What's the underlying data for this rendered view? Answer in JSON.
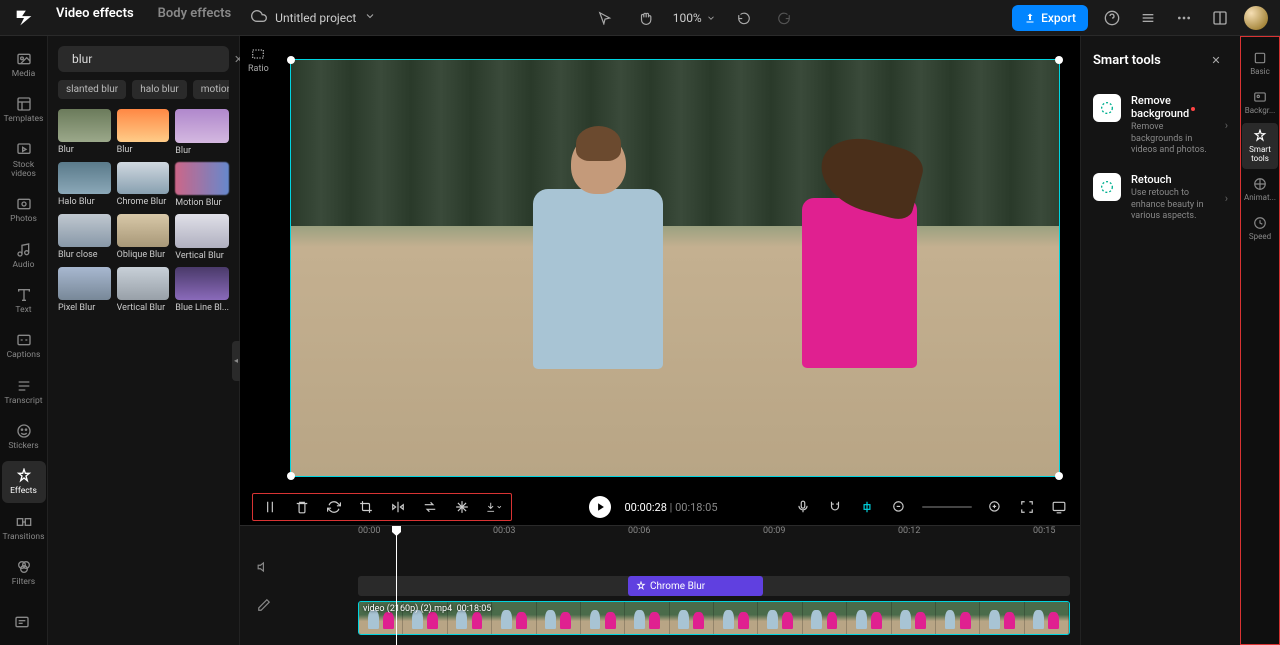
{
  "topbar": {
    "tabs": [
      "Video effects",
      "Body effects"
    ],
    "activeTab": 0,
    "projectName": "Untitled project",
    "zoom": "100%",
    "exportLabel": "Export"
  },
  "navRail": [
    {
      "label": "Media",
      "icon": "media"
    },
    {
      "label": "Templates",
      "icon": "templates"
    },
    {
      "label": "Stock videos",
      "icon": "stock"
    },
    {
      "label": "Photos",
      "icon": "photos"
    },
    {
      "label": "Audio",
      "icon": "audio"
    },
    {
      "label": "Text",
      "icon": "text"
    },
    {
      "label": "Captions",
      "icon": "captions"
    },
    {
      "label": "Transcript",
      "icon": "transcript"
    },
    {
      "label": "Stickers",
      "icon": "stickers"
    },
    {
      "label": "Effects",
      "icon": "effects"
    },
    {
      "label": "Transitions",
      "icon": "transitions"
    },
    {
      "label": "Filters",
      "icon": "filters"
    }
  ],
  "navRailActive": 9,
  "sidebar": {
    "searchValue": "blur",
    "chips": [
      "slanted blur",
      "halo blur",
      "motion bl..."
    ],
    "effects": [
      {
        "label": "Blur",
        "th": "th-1"
      },
      {
        "label": "Blur",
        "th": "th-2"
      },
      {
        "label": "Blur",
        "th": "th-3"
      },
      {
        "label": "Halo Blur",
        "th": "th-4"
      },
      {
        "label": "Chrome Blur",
        "th": "th-5"
      },
      {
        "label": "Motion Blur",
        "th": "th-6"
      },
      {
        "label": "Blur close",
        "th": "th-7"
      },
      {
        "label": "Oblique Blur",
        "th": "th-8"
      },
      {
        "label": "Vertical Blur",
        "th": "th-9"
      },
      {
        "label": "Pixel Blur",
        "th": "th-10"
      },
      {
        "label": "Vertical Blur",
        "th": "th-11"
      },
      {
        "label": "Blue Line Bl...",
        "th": "th-12"
      }
    ]
  },
  "canvas": {
    "ratioLabel": "Ratio"
  },
  "playback": {
    "current": "00:00:28",
    "duration": "00:18:05"
  },
  "timeline": {
    "ticks": [
      "00:00",
      "00:03",
      "00:06",
      "00:09",
      "00:12",
      "00:15"
    ],
    "effectClip": "Chrome Blur",
    "videoLabel": "video (2160p) (2).mp4",
    "videoDuration": "00:18:05"
  },
  "smartPanel": {
    "title": "Smart tools",
    "items": [
      {
        "title": "Remove background",
        "desc": "Remove backgrounds in videos and photos.",
        "badge": true
      },
      {
        "title": "Retouch",
        "desc": "Use retouch to enhance beauty in various aspects.",
        "badge": false
      }
    ]
  },
  "propRail": [
    {
      "label": "Basic"
    },
    {
      "label": "Backgr..."
    },
    {
      "label": "Smart tools"
    },
    {
      "label": "Animat..."
    },
    {
      "label": "Speed"
    }
  ],
  "propRailActive": 2
}
